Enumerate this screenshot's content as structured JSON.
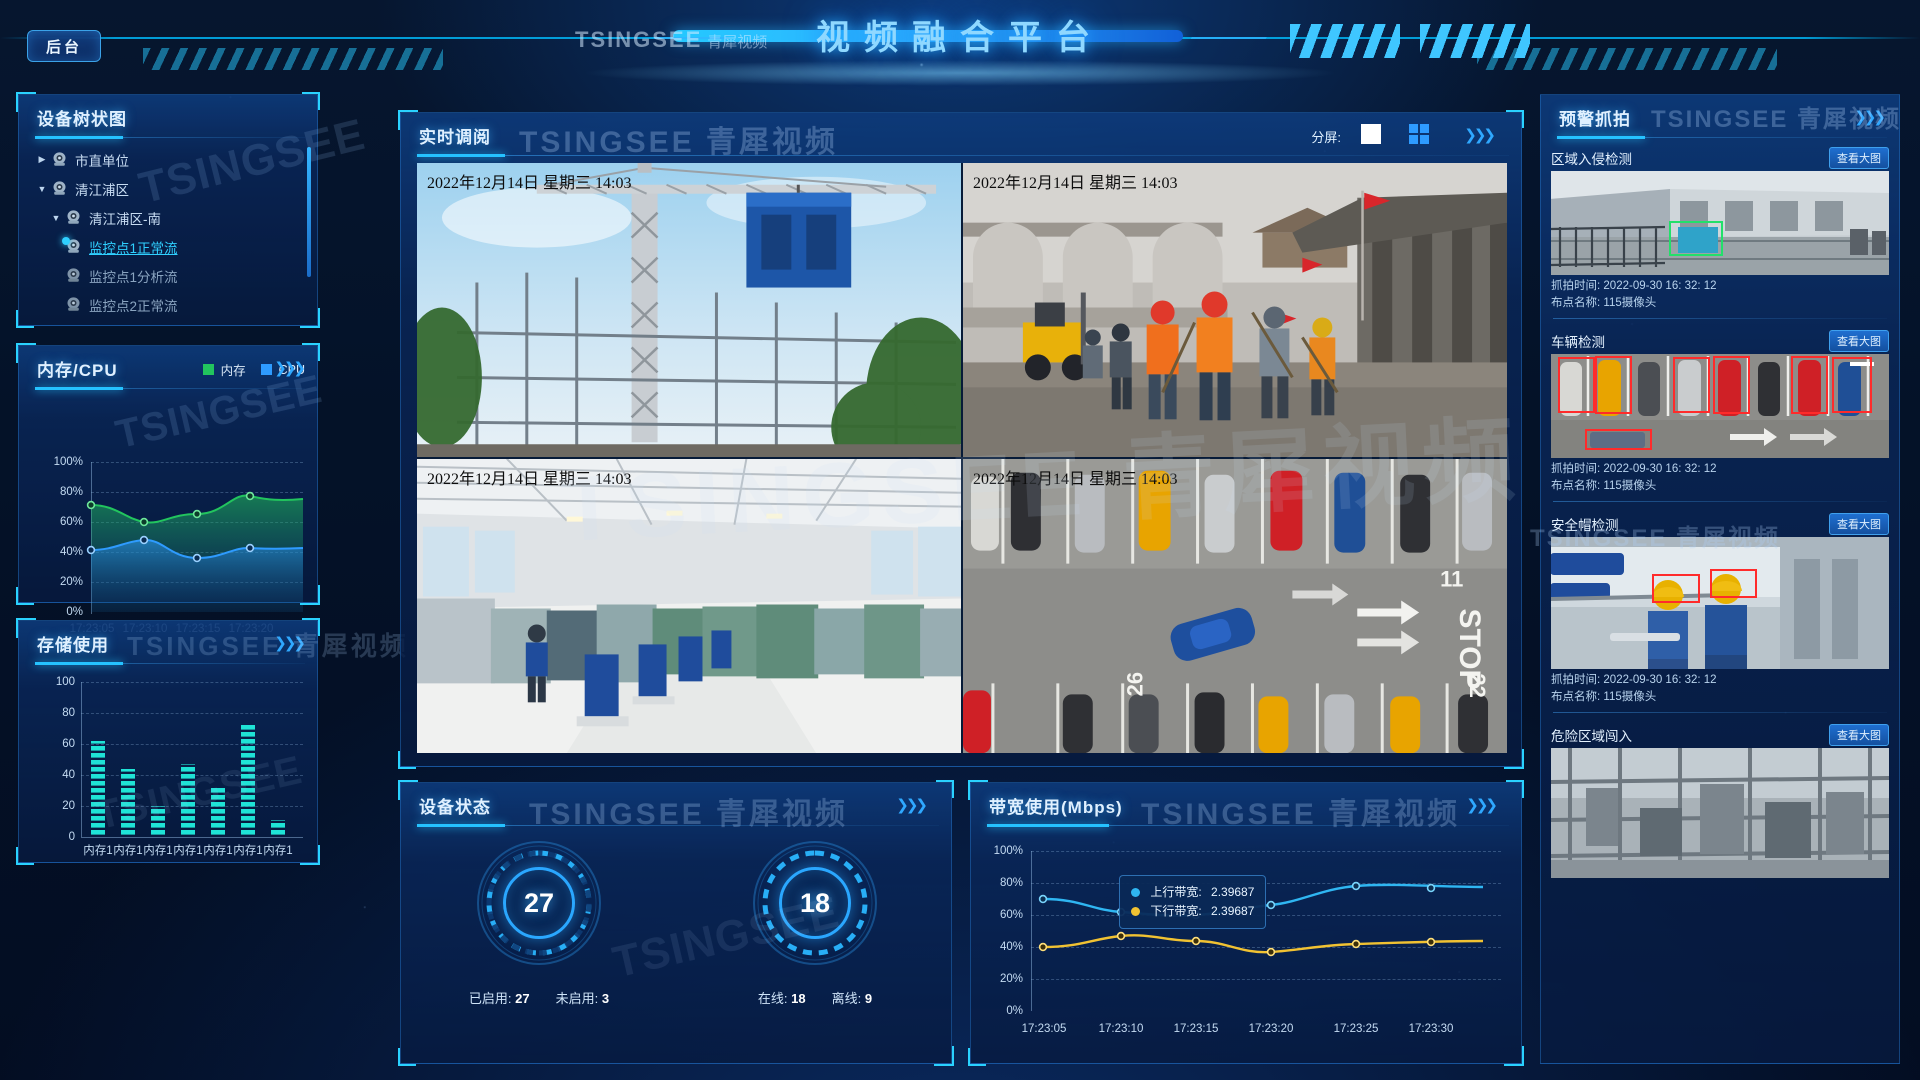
{
  "header": {
    "backstage": "后台",
    "title": "视频融合平台",
    "brand_latin": "TSINGSEE",
    "brand_cn": "青犀视频"
  },
  "device_tree": {
    "title": "设备树状图",
    "nodes": [
      {
        "label": "市直单位",
        "arrow": "right",
        "state": "normal",
        "indent": 0
      },
      {
        "label": "清江浦区",
        "arrow": "down",
        "state": "normal",
        "indent": 0
      },
      {
        "label": "清江浦区-南",
        "arrow": "down",
        "state": "normal",
        "indent": 1
      },
      {
        "label": "监控点1正常流",
        "arrow": "none",
        "state": "active",
        "indent": 2
      },
      {
        "label": "监控点1分析流",
        "arrow": "none",
        "state": "dim",
        "indent": 2
      },
      {
        "label": "监控点2正常流",
        "arrow": "none",
        "state": "dim",
        "indent": 2
      }
    ]
  },
  "mem_cpu": {
    "title": "内存/CPU",
    "legend": [
      {
        "name": "内存",
        "color": "#22c55e"
      },
      {
        "name": "CPU",
        "color": "#2e9bff"
      }
    ]
  },
  "storage": {
    "title": "存储使用"
  },
  "live": {
    "title": "实时调阅",
    "split_label": "分屏:",
    "split_options": [
      "1",
      "4"
    ],
    "split_selected": "4",
    "cells": [
      {
        "timestamp": "2022年12月14日  星期三  14:03",
        "scene": "construction-crane"
      },
      {
        "timestamp": "2022年12月14日  星期三  14:03",
        "scene": "roadworks-crew"
      },
      {
        "timestamp": "2022年12月14日  星期三  14:03",
        "scene": "factory-floor"
      },
      {
        "timestamp": "2022年12月14日  星期三  14:03",
        "scene": "parking-lot"
      }
    ]
  },
  "device_status": {
    "title": "设备状态",
    "gauges": [
      {
        "value": "27",
        "stats": [
          {
            "label": "已启用:",
            "value": "27"
          },
          {
            "label": "未启用:",
            "value": "3"
          }
        ]
      },
      {
        "value": "18",
        "stats": [
          {
            "label": "在线:",
            "value": "18"
          },
          {
            "label": "离线:",
            "value": "9"
          }
        ]
      }
    ]
  },
  "bandwidth": {
    "title": "带宽使用(Mbps)",
    "tooltip": [
      {
        "label": "上行带宽:",
        "value": "2.39687",
        "color": "#2fb6f2"
      },
      {
        "label": "下行带宽:",
        "value": "2.39687",
        "color": "#f1c232"
      }
    ]
  },
  "alarms": {
    "title": "预警抓拍",
    "view_label": "查看大图",
    "cards": [
      {
        "title": "区域入侵检测",
        "time_label": "抓拍时间:",
        "time_value": "2022-09-30  16: 32: 12",
        "site_label": "布点名称:",
        "site_value": "115摄像头",
        "scene": "warehouse-fence"
      },
      {
        "title": "车辆检测",
        "time_label": "抓拍时间:",
        "time_value": "2022-09-30  16: 32: 12",
        "site_label": "布点名称:",
        "site_value": "115摄像头",
        "scene": "parking-detection"
      },
      {
        "title": "安全帽检测",
        "time_label": "抓拍时间:",
        "time_value": "2022-09-30  16: 32: 12",
        "site_label": "布点名称:",
        "site_value": "115摄像头",
        "scene": "helmet-workers"
      },
      {
        "title": "危险区域闯入",
        "time_label": "",
        "time_value": "",
        "site_label": "",
        "site_value": "",
        "scene": "industrial-plant"
      }
    ]
  },
  "chart_data": [
    {
      "type": "area",
      "id": "mem-cpu",
      "title": "内存/CPU",
      "xlabel": "",
      "ylabel": "",
      "ylim": [
        0,
        100
      ],
      "yticks": [
        "0%",
        "20%",
        "40%",
        "60%",
        "80%",
        "100%"
      ],
      "grid": true,
      "legend_position": "top-right",
      "x": [
        "17:23:05",
        "17:23:10",
        "17:23:15",
        "17:23:20"
      ],
      "series": [
        {
          "name": "内存",
          "color": "#22c55e",
          "values": [
            71,
            65,
            65,
            76,
            73
          ]
        },
        {
          "name": "CPU",
          "color": "#2e9bff",
          "values": [
            41,
            47,
            36,
            44,
            43
          ]
        }
      ]
    },
    {
      "type": "bar",
      "id": "storage",
      "title": "存储使用",
      "ylim": [
        0,
        100
      ],
      "yticks": [
        "0",
        "20",
        "40",
        "60",
        "80",
        "100"
      ],
      "grid": true,
      "categories": [
        "内存1",
        "内存1",
        "内存1",
        "内存1",
        "内存1",
        "内存1",
        "内存1"
      ],
      "values": [
        62,
        44,
        20,
        47,
        32,
        73,
        11
      ],
      "bar_color": "#1fe3d6"
    },
    {
      "type": "line",
      "id": "bandwidth",
      "title": "带宽使用(Mbps)",
      "ylim": [
        0,
        100
      ],
      "yticks": [
        "0%",
        "20%",
        "40%",
        "60%",
        "80%",
        "100%"
      ],
      "grid": true,
      "x": [
        "17:23:05",
        "17:23:10",
        "17:23:15",
        "17:23:20",
        "17:23:25",
        "17:23:30"
      ],
      "series": [
        {
          "name": "上行带宽",
          "color": "#2fb6f2",
          "values": [
            70,
            63,
            60,
            62,
            70,
            68
          ]
        },
        {
          "name": "下行带宽",
          "color": "#f1c232",
          "values": [
            40,
            47,
            44,
            37,
            41,
            44
          ]
        }
      ]
    },
    {
      "type": "gauge",
      "id": "device-enabled",
      "value": 27,
      "labels": [
        "已启用: 27",
        "未启用: 3"
      ]
    },
    {
      "type": "gauge",
      "id": "device-online",
      "value": 18,
      "labels": [
        "在线: 18",
        "离线: 9"
      ]
    }
  ]
}
